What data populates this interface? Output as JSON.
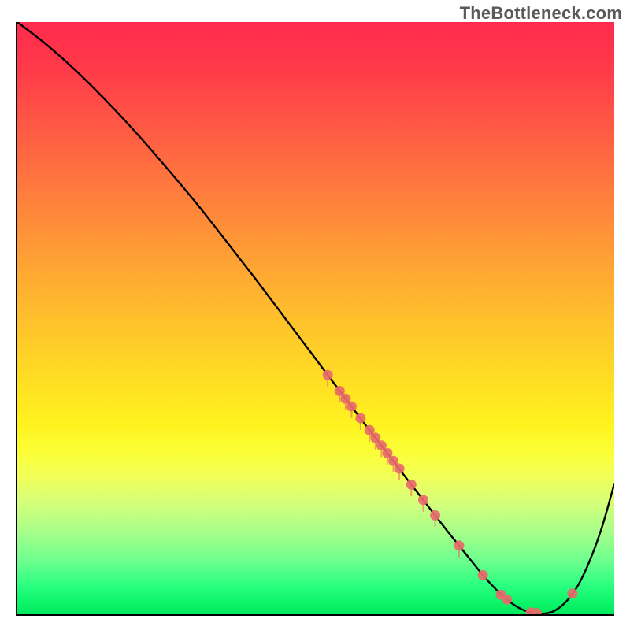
{
  "watermark": "TheBottleneck.com",
  "chart_data": {
    "type": "line",
    "title": "",
    "xlabel": "",
    "ylabel": "",
    "xlim": [
      0,
      100
    ],
    "ylim": [
      0,
      100
    ],
    "grid": false,
    "legend": false,
    "series": [
      {
        "name": "bottleneck-curve",
        "color": "#000000",
        "x": [
          0,
          5,
          10,
          15,
          20,
          25,
          30,
          35,
          40,
          45,
          50,
          52,
          55,
          58,
          60,
          62,
          65,
          68,
          70,
          72,
          74,
          76,
          78,
          80,
          82,
          84,
          86,
          88,
          90,
          92,
          94,
          96,
          98,
          100
        ],
        "y": [
          100,
          96.1,
          91.6,
          86.6,
          81.2,
          75.4,
          69.4,
          63.0,
          56.5,
          49.8,
          43.1,
          40.4,
          36.4,
          32.4,
          29.8,
          27.2,
          23.2,
          19.3,
          16.7,
          14.1,
          11.6,
          9.1,
          6.6,
          4.4,
          2.5,
          1.1,
          0.3,
          0.1,
          0.6,
          2.2,
          5.0,
          9.3,
          14.9,
          22.0
        ]
      }
    ],
    "markers": [
      {
        "name": "data-points",
        "color": "#e86a6a",
        "x": [
          52,
          54,
          55,
          56,
          57.5,
          59,
          60,
          61,
          62,
          63,
          64,
          66,
          68,
          70,
          74,
          78,
          81,
          82,
          86,
          87,
          93
        ],
        "y": [
          40.4,
          37.7,
          36.4,
          35.1,
          33.1,
          31.1,
          29.8,
          28.5,
          27.2,
          25.9,
          24.6,
          21.9,
          19.3,
          16.7,
          11.6,
          6.6,
          3.3,
          2.5,
          0.3,
          0.2,
          3.5
        ]
      }
    ]
  }
}
